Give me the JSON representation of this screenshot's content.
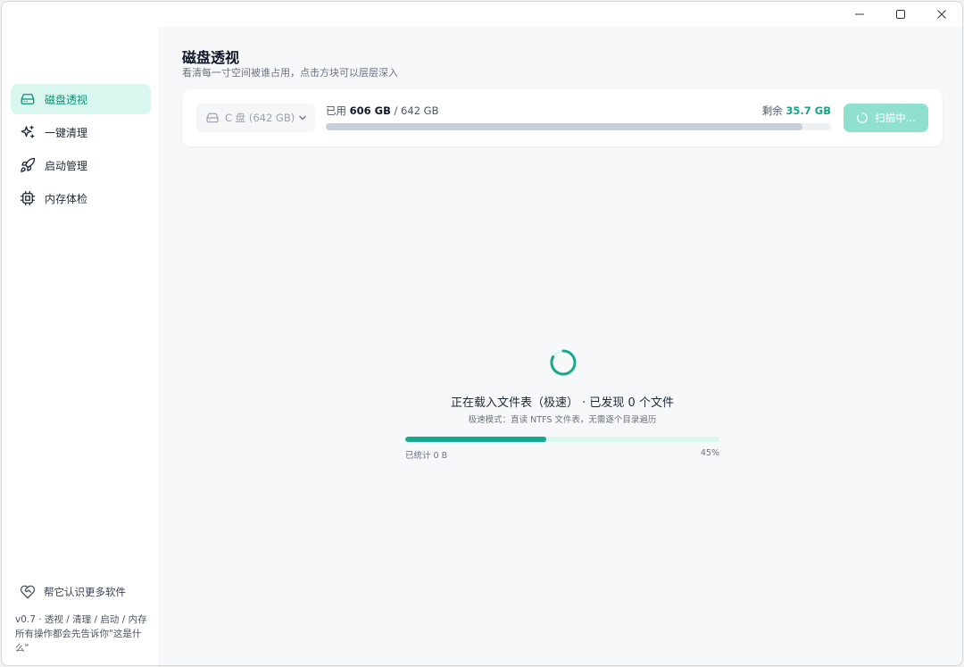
{
  "window": {
    "controls": [
      "minimize",
      "maximize",
      "close"
    ]
  },
  "sidebar": {
    "items": [
      {
        "label": "磁盘透视",
        "icon": "hard-drive-icon",
        "active": true
      },
      {
        "label": "一键清理",
        "icon": "sparkles-icon",
        "active": false
      },
      {
        "label": "启动管理",
        "icon": "rocket-icon",
        "active": false
      },
      {
        "label": "内存体检",
        "icon": "chip-icon",
        "active": false
      }
    ],
    "footer_link": "帮它认识更多软件",
    "footer_link_icon": "heart-handshake-icon",
    "footer_text": "v0.7 · 透视 / 清理 / 启动 / 内存 所有操作都会先告诉你\"这是什么\""
  },
  "header": {
    "title": "磁盘透视",
    "subtitle": "看清每一寸空间被谁占用，点击方块可以层层深入"
  },
  "disk": {
    "drive_label": "C 盘 (642 GB)",
    "used_label": "已用",
    "used_value": "606 GB",
    "total_value": "/ 642 GB",
    "free_label": "剩余",
    "free_value": "35.7 GB",
    "used_fraction": 0.944,
    "scan_button": "扫描中..."
  },
  "loading": {
    "title": "正在载入文件表（极速） · 已发现 0 个文件",
    "subtitle": "极速模式：直读 NTFS 文件表，无需逐个目录遍历",
    "counted_label": "已统计 0 B",
    "percent_label": "45%",
    "progress": 0.45
  },
  "colors": {
    "accent": "#18a88f",
    "accent_light": "#d9f7ee",
    "scan_button": "#8fe0cf"
  }
}
